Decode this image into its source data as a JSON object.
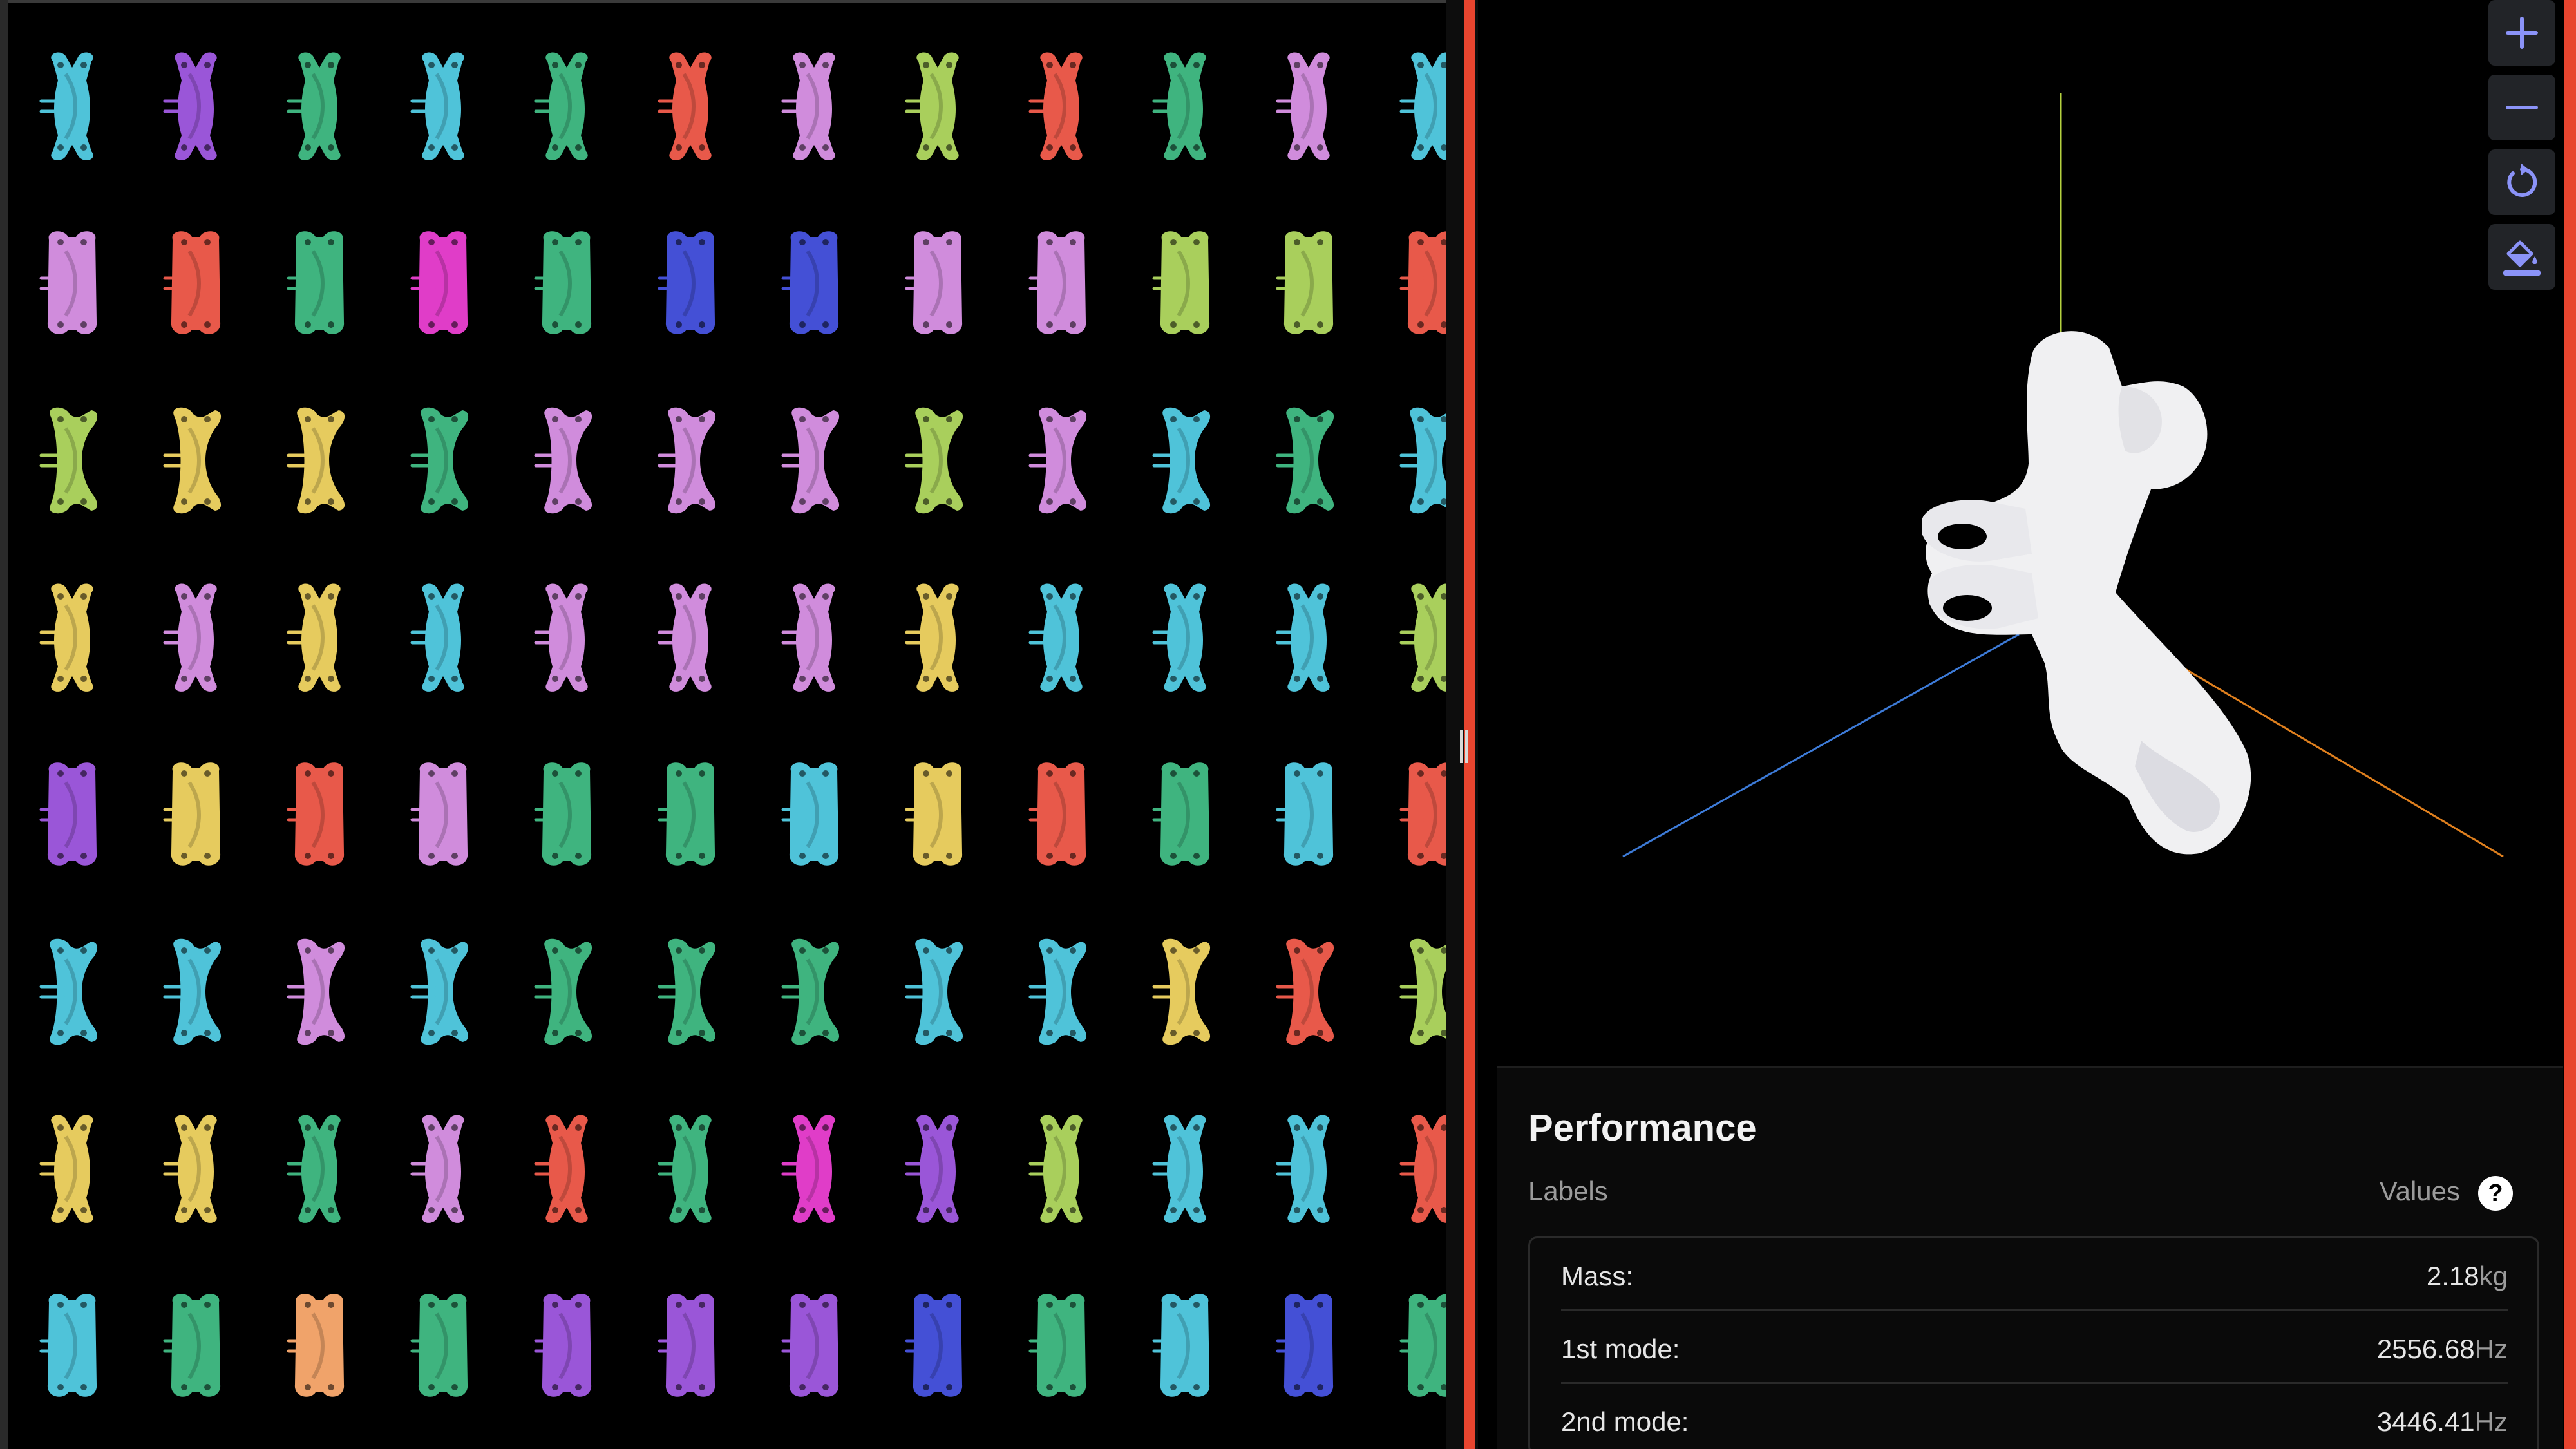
{
  "parts_grid": {
    "columns": 12,
    "rows": 8,
    "palette": {
      "C": "#4fc3d9",
      "V": "#9a56d8",
      "G": "#3fb47f",
      "R": "#e8594a",
      "P": "#d08cdc",
      "L": "#a9cf5c",
      "Y": "#e6cb5e",
      "M": "#e03dc8",
      "B": "#4450d6",
      "O": "#f0a36a"
    },
    "cells": [
      "CVGCGRPLRGPC",
      "PRGMGBBPPLLR",
      "LYYGPPPLPCGC",
      "YPYCPPPYCCCL",
      "VYRPGGCYRGCR",
      "CCPCGGGCCYRL",
      "YYGPRGMVLCCR",
      "CGOGVVVBGCBG"
    ]
  },
  "viewer": {
    "background": "#000000",
    "axis_colors": {
      "y": "#b5d23f",
      "x": "#e0801e",
      "z": "#3d7bd8"
    },
    "part_color": "#f0f0f2"
  },
  "toolbar": {
    "buttons": [
      {
        "name": "zoom-in-button",
        "icon": "plus-icon"
      },
      {
        "name": "zoom-out-button",
        "icon": "minus-icon"
      },
      {
        "name": "reset-view-button",
        "icon": "rotate-icon"
      },
      {
        "name": "color-fill-button",
        "icon": "paint-bucket-icon"
      }
    ],
    "icon_color": "#8b93f8"
  },
  "performance": {
    "title": "Performance",
    "labels_header": "Labels",
    "values_header": "Values",
    "help_icon": "?",
    "rows": [
      {
        "label": "Mass:",
        "value": "2.18",
        "unit": "kg"
      },
      {
        "label": "1st mode:",
        "value": "2556.68",
        "unit": "Hz"
      },
      {
        "label": "2nd mode:",
        "value": "3446.41",
        "unit": "Hz"
      }
    ]
  }
}
